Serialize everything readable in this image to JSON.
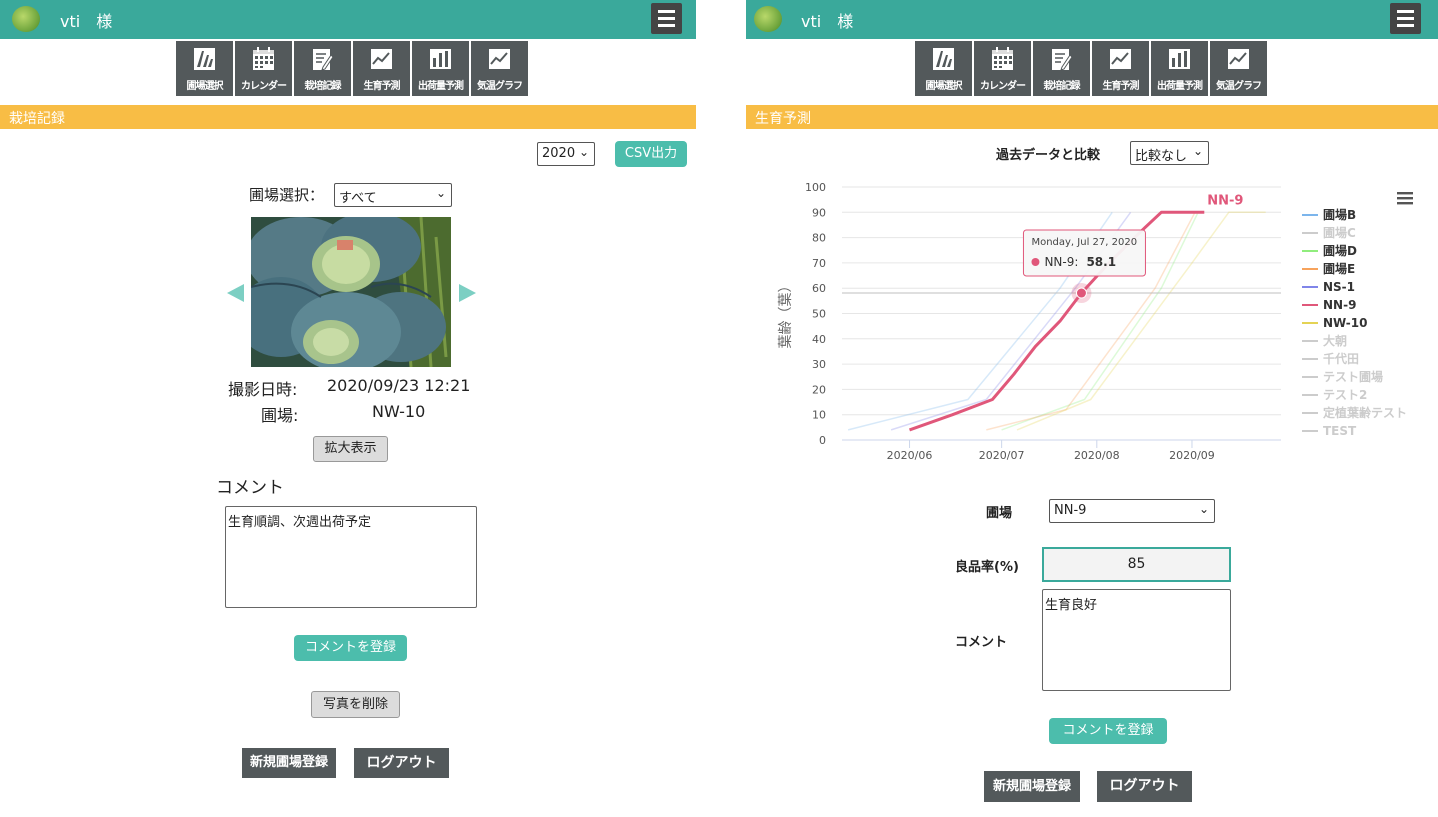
{
  "left": {
    "username": "vti　様",
    "nav": [
      {
        "label": "圃場選択",
        "icon": "field-select-icon"
      },
      {
        "label": "カレンダー",
        "icon": "calendar-icon"
      },
      {
        "label": "栽培記録",
        "icon": "record-edit-icon"
      },
      {
        "label": "生育予測",
        "icon": "line-graph-icon"
      },
      {
        "label": "出荷量予測",
        "icon": "bar-graph-icon"
      },
      {
        "label": "気温グラフ",
        "icon": "line-graph-icon"
      }
    ],
    "section_title": "栽培記録",
    "year_select": "2020",
    "csv_button": "CSV出力",
    "field_select_label": "圃場選択：",
    "field_select_value": "すべて",
    "photo_date_label": "撮影日時:",
    "photo_date_value": "2020/09/23 12:21",
    "field_label": "圃場:",
    "field_value": "NW-10",
    "zoom_button": "拡大表示",
    "comment_heading": "コメント",
    "comment_text": "生育順調、次週出荷予定",
    "register_comment_button": "コメントを登録",
    "delete_photo_button": "写真を削除",
    "new_field_button": "新規圃場登録",
    "logout_button": "ログアウト"
  },
  "right": {
    "username": "vti　様",
    "nav": [
      {
        "label": "圃場選択",
        "icon": "field-select-icon"
      },
      {
        "label": "カレンダー",
        "icon": "calendar-icon"
      },
      {
        "label": "栽培記録",
        "icon": "record-edit-icon"
      },
      {
        "label": "生育予測",
        "icon": "line-graph-icon"
      },
      {
        "label": "出荷量予測",
        "icon": "bar-graph-icon"
      },
      {
        "label": "気温グラフ",
        "icon": "line-graph-icon"
      }
    ],
    "section_title": "生育予測",
    "compare_label": "過去データと比較",
    "compare_select": "比較なし",
    "field_label": "圃場",
    "field_select": "NN-9",
    "quality_label": "良品率(%)",
    "quality_value": "85",
    "comment_label": "コメント",
    "comment_text": "生育良好",
    "register_comment_button": "コメントを登録",
    "new_field_button": "新規圃場登録",
    "logout_button": "ログアウト"
  },
  "colors": {
    "header": "#3aa99b",
    "section": "#f8bd45",
    "nav": "#53595b",
    "teal_button": "#4cbdac",
    "highlight_series": "#e0577a"
  },
  "chart_data": {
    "type": "line",
    "ylabel": "葉齢（葉）",
    "xlabel": "",
    "ylim": [
      0,
      100
    ],
    "yticks": [
      0,
      10,
      20,
      30,
      40,
      50,
      60,
      70,
      80,
      90,
      100
    ],
    "xticks": [
      "2020/06",
      "2020/07",
      "2020/08",
      "2020/09"
    ],
    "xrange": [
      "2020-05-10",
      "2020-09-30"
    ],
    "grid": true,
    "legend_position": "right",
    "highlight_label": "NN-9",
    "tooltip": {
      "date": "Monday, Jul 27, 2020",
      "series": "NN-9",
      "value": "58.1"
    },
    "series": [
      {
        "name": "圃場B",
        "color": "#7cb5ec",
        "faded": true,
        "legend_active": true,
        "points": [
          [
            "2020-05-12",
            4
          ],
          [
            "2020-06-20",
            16
          ],
          [
            "2020-07-20",
            60
          ],
          [
            "2020-08-06",
            90
          ]
        ]
      },
      {
        "name": "圃場C",
        "color": "#cccccc",
        "faded": true,
        "legend_active": false,
        "points": []
      },
      {
        "name": "圃場D",
        "color": "#90ed7d",
        "faded": true,
        "legend_active": true,
        "points": [
          [
            "2020-07-01",
            4
          ],
          [
            "2020-07-28",
            16
          ],
          [
            "2020-08-22",
            60
          ],
          [
            "2020-09-03",
            90
          ]
        ]
      },
      {
        "name": "圃場E",
        "color": "#f7a35c",
        "faded": true,
        "legend_active": true,
        "points": [
          [
            "2020-06-26",
            4
          ],
          [
            "2020-07-22",
            12
          ],
          [
            "2020-08-20",
            60
          ],
          [
            "2020-09-02",
            90
          ]
        ]
      },
      {
        "name": "NS-1",
        "color": "#8085e9",
        "faded": true,
        "legend_active": true,
        "points": [
          [
            "2020-05-26",
            4
          ],
          [
            "2020-06-26",
            16
          ],
          [
            "2020-07-25",
            60
          ],
          [
            "2020-08-12",
            90
          ]
        ]
      },
      {
        "name": "NN-9",
        "color": "#e0577a",
        "faded": false,
        "legend_active": true,
        "points": [
          [
            "2020-06-01",
            4
          ],
          [
            "2020-06-15",
            10
          ],
          [
            "2020-06-28",
            16
          ],
          [
            "2020-07-05",
            26
          ],
          [
            "2020-07-12",
            37
          ],
          [
            "2020-07-20",
            47
          ],
          [
            "2020-07-27",
            58.1
          ],
          [
            "2020-08-05",
            70
          ],
          [
            "2020-08-15",
            82
          ],
          [
            "2020-08-22",
            90
          ],
          [
            "2020-09-05",
            90
          ]
        ]
      },
      {
        "name": "NW-10",
        "color": "#e4d354",
        "faded": true,
        "legend_active": true,
        "points": [
          [
            "2020-07-06",
            4
          ],
          [
            "2020-07-30",
            16
          ],
          [
            "2020-09-01",
            70
          ],
          [
            "2020-09-13",
            90
          ],
          [
            "2020-09-25",
            90
          ]
        ]
      },
      {
        "name": "大朝",
        "color": "#cccccc",
        "faded": true,
        "legend_active": false,
        "points": []
      },
      {
        "name": "千代田",
        "color": "#cccccc",
        "faded": true,
        "legend_active": false,
        "points": []
      },
      {
        "name": "テスト圃場",
        "color": "#cccccc",
        "faded": true,
        "legend_active": false,
        "points": []
      },
      {
        "name": "テスト2",
        "color": "#cccccc",
        "faded": true,
        "legend_active": false,
        "points": []
      },
      {
        "name": "定植葉齢テスト",
        "color": "#cccccc",
        "faded": true,
        "legend_active": false,
        "points": []
      },
      {
        "name": "TEST",
        "color": "#cccccc",
        "faded": true,
        "legend_active": false,
        "points": []
      }
    ]
  }
}
